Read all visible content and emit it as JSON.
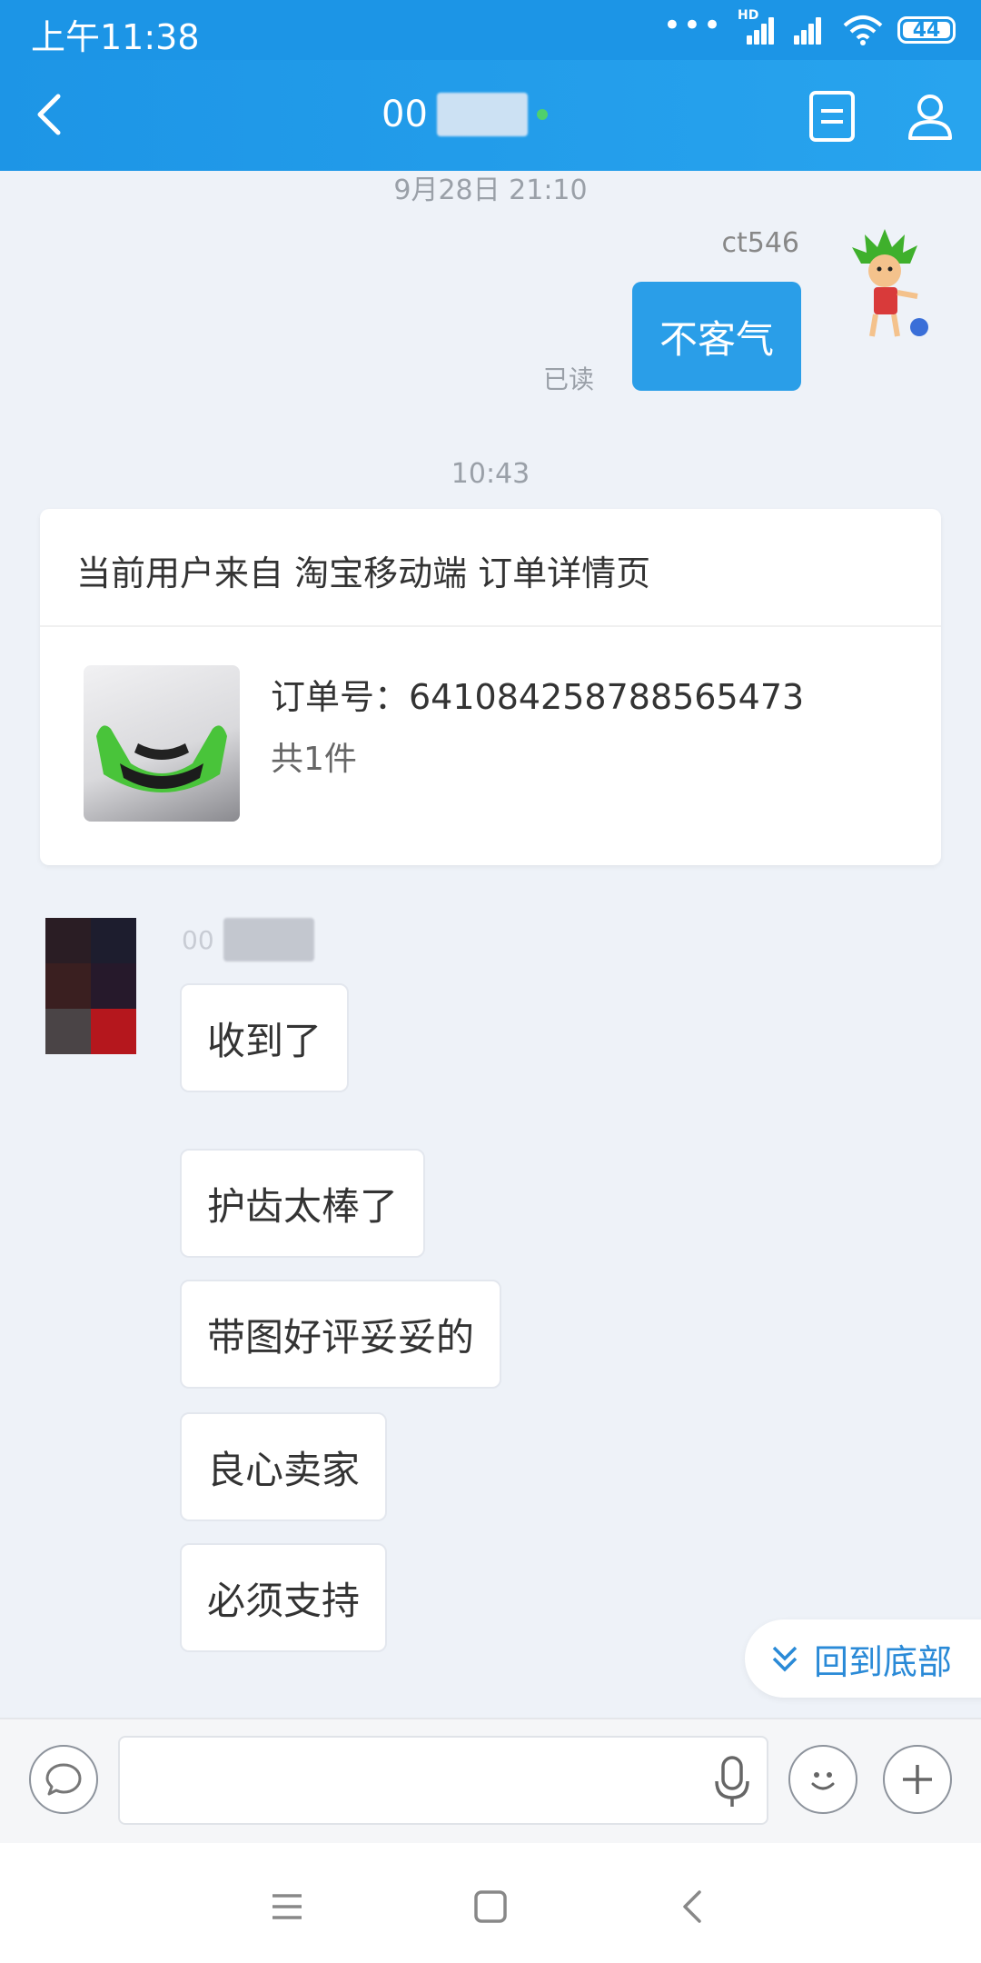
{
  "status_bar": {
    "time": "上午11:38",
    "network_type": "HD",
    "battery": "44"
  },
  "header": {
    "contact_name_visible": "00",
    "back_icon": "chevron-left-icon",
    "detail_icon": "document-icon",
    "profile_icon": "user-icon"
  },
  "messages": {
    "timestamp_top": "9月28日 21:10",
    "outgoing_sender": "ct546",
    "outgoing_text": "不客气",
    "read_status": "已读",
    "timestamp_second": "10:43",
    "peer_name_visible": "00"
  },
  "order_card": {
    "source": "当前用户来自 淘宝移动端 订单详情页",
    "order_label": "订单号：641084258788565473",
    "item_count": "共1件"
  },
  "incoming_messages": [
    "收到了",
    "护齿太棒了",
    "带图好评妥妥的",
    "良心卖家",
    "必须支持"
  ],
  "back_to_bottom": "回到底部",
  "input": {
    "placeholder": "",
    "left_icon": "chat-bubble-icon",
    "mic_icon": "microphone-icon",
    "emoji_icon": "smiley-icon",
    "plus_icon": "plus-icon"
  },
  "colors": {
    "header_blue": "#1c95e6",
    "bubble_blue": "#2a9ee8",
    "background": "#eef2f8",
    "link_blue": "#2a8ad7"
  }
}
